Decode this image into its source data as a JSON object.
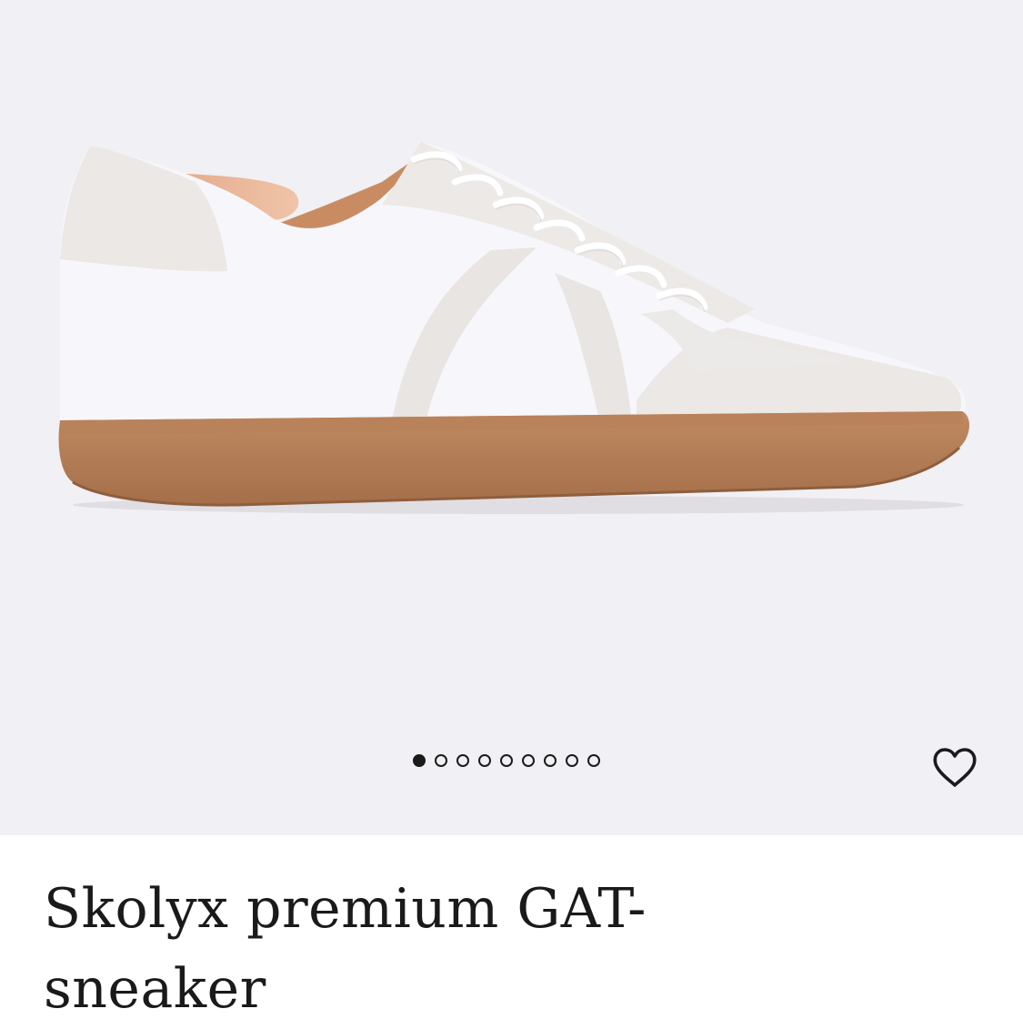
{
  "product": {
    "title": "Skolyx premium GAT-sneaker",
    "image_alt": "White leather GAT sneaker with light grey suede overlays and gum sole",
    "favorite_icon": "heart-outline-icon"
  },
  "gallery": {
    "image_count": 9,
    "active_index": 0
  },
  "colors": {
    "gallery_bg": "#f1f0f4",
    "text": "#1a1a1a",
    "sole": "#b9825a"
  }
}
